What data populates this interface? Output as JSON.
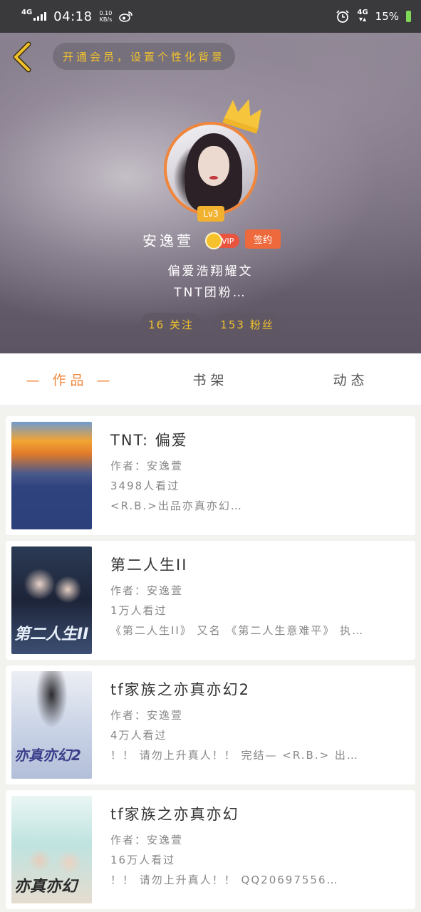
{
  "status_bar": {
    "network_left": "4G",
    "time": "04:18",
    "speed_value": "0.10",
    "speed_unit": "KB/s",
    "network_right": "4G",
    "battery": "15%"
  },
  "header": {
    "vip_banner": "开通会员，设置个性化背景",
    "level": "Lv3",
    "username": "安逸萱",
    "vip_label": "VIP",
    "sign_label": "签约",
    "bio_line1": "偏爱浩翔耀文",
    "bio_line2": "TNT团粉…",
    "following": "16 关注",
    "fans": "153 粉丝"
  },
  "tabs": [
    {
      "label": "— 作品 —",
      "active": true
    },
    {
      "label": "书架",
      "active": false
    },
    {
      "label": "动态",
      "active": false
    }
  ],
  "works": [
    {
      "title": "TNT:  偏爱",
      "author": "作者：安逸萱",
      "views": "3498人看过",
      "desc": "<R.B.>出品亦真亦幻…"
    },
    {
      "title": "第二人生II",
      "author": "作者：安逸萱",
      "views": "1万人看过",
      "desc": "《第二人生II》 又名 《第二人生意难平》 执…",
      "cover_text": "第二人生II"
    },
    {
      "title": "tf家族之亦真亦幻2",
      "author": "作者：安逸萱",
      "views": "4万人看过",
      "desc": "！！ 请勿上升真人！！ 完结— <R.B.> 出…",
      "cover_text": "亦真亦幻2"
    },
    {
      "title": "tf家族之亦真亦幻",
      "author": "作者：安逸萱",
      "views": "16万人看过",
      "desc": "！！ 请勿上升真人！！ QQ20697556…",
      "cover_text": "亦真亦幻"
    }
  ]
}
